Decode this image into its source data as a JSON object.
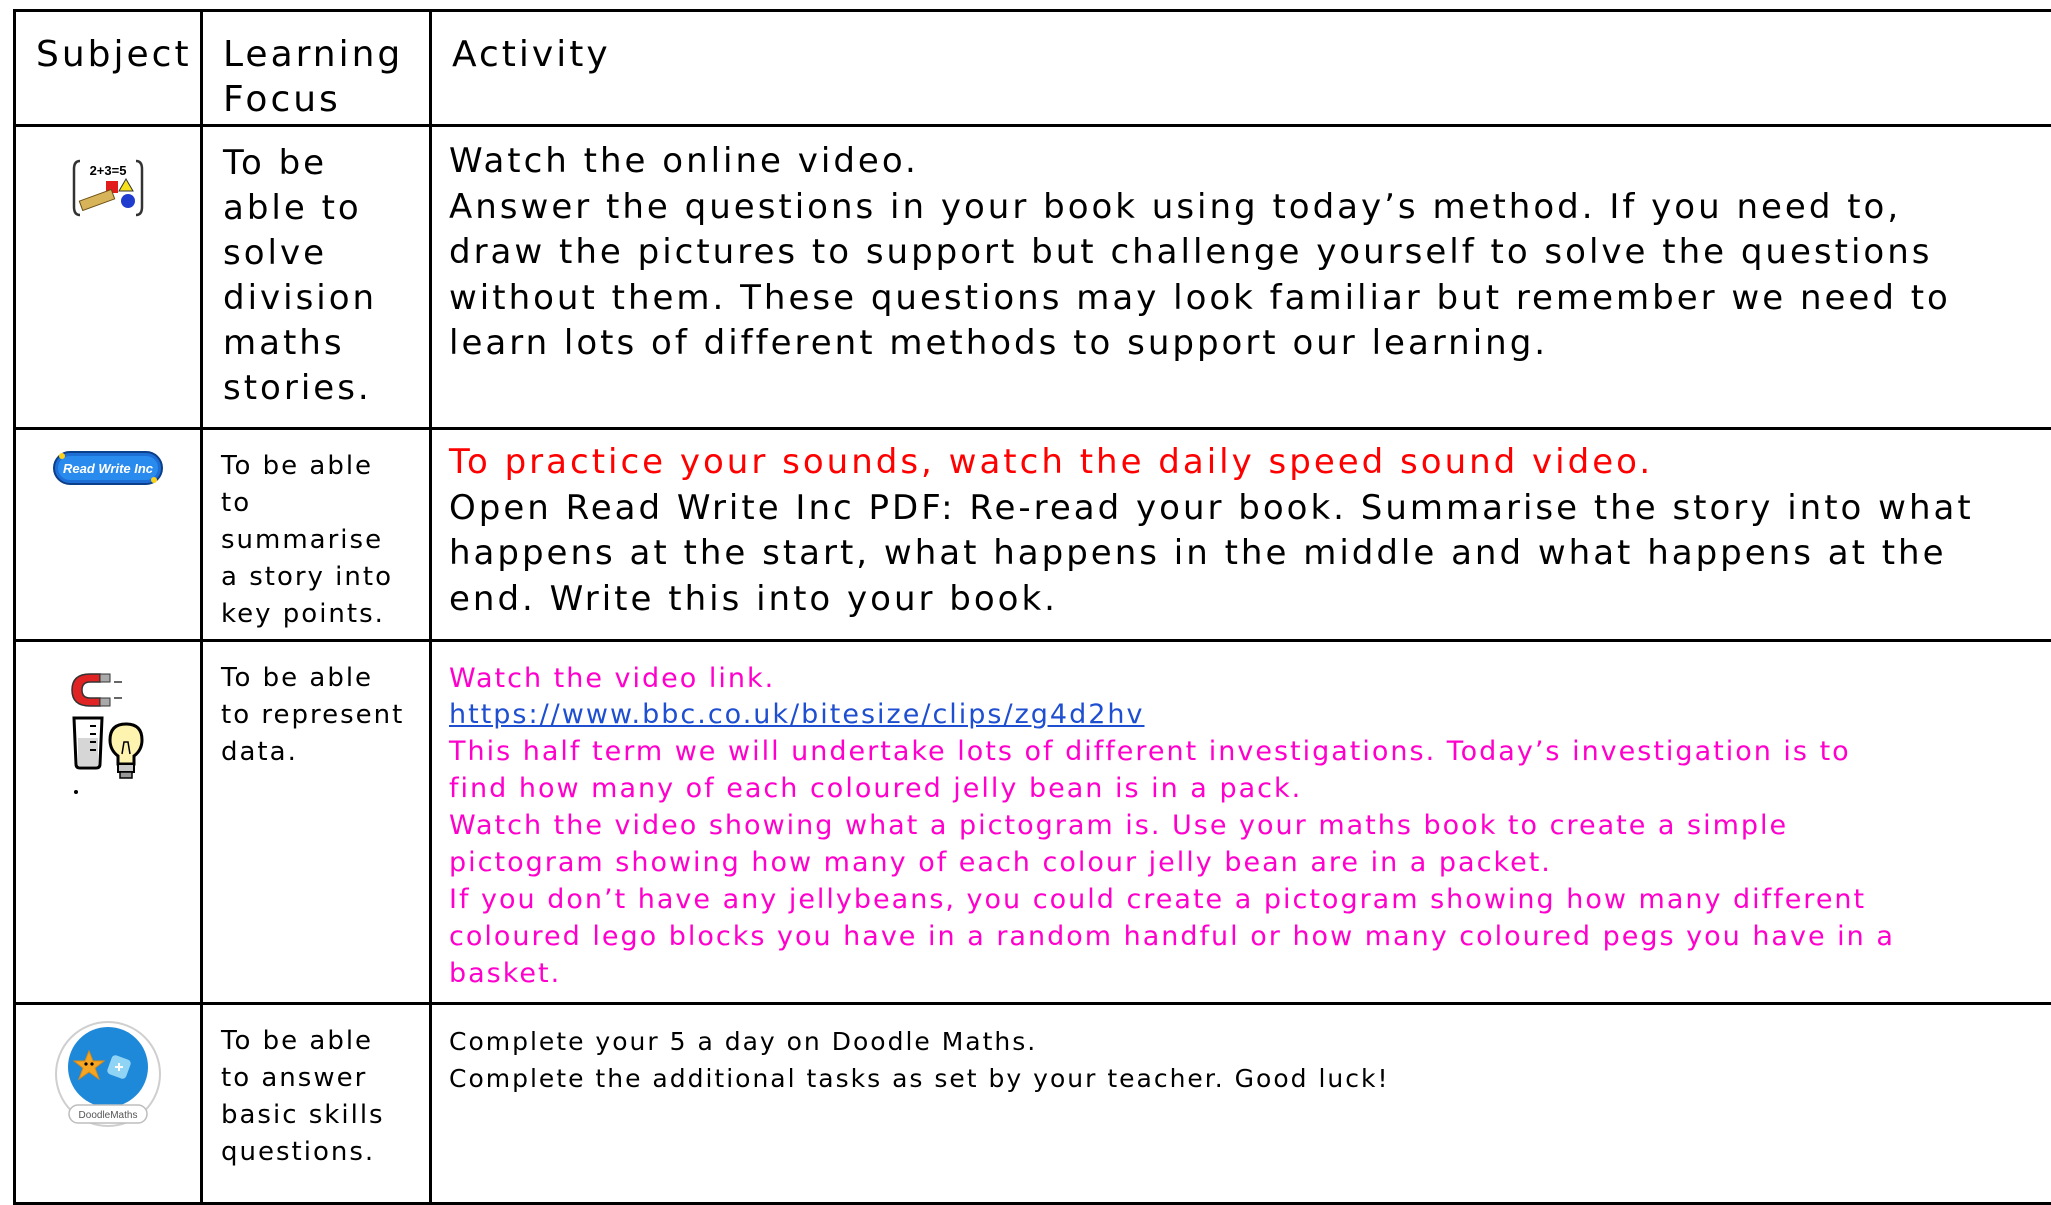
{
  "header": {
    "subject": "Subject",
    "focus_line1": "Learning",
    "focus_line2": "Focus",
    "activity": "Activity"
  },
  "rows": [
    {
      "icon": "maths-icon",
      "icon_text": "2+3=5",
      "focus": [
        "To be",
        "able to",
        "solve",
        "division",
        "maths",
        "stories."
      ],
      "activity": [
        "Watch the online video.",
        "Answer the questions in your book using today’s method. If you need to,",
        "draw the pictures to support but challenge yourself to solve the questions",
        "without them. These questions may look familiar but remember we need to",
        "learn lots of different methods to support our learning."
      ]
    },
    {
      "icon": "read-write-inc-logo",
      "icon_text": "Read Write Inc",
      "focus": [
        "To be able",
        "to",
        "summarise",
        "a story into",
        "key points."
      ],
      "activity_highlight": "To practice your sounds, watch the daily speed sound video.",
      "activity": [
        "Open Read Write Inc PDF: Re-read your book. Summarise the story into what",
        "happens at the start, what happens in the middle and what happens at the",
        "end. Write this into your book."
      ]
    },
    {
      "icon": "science-icon",
      "focus": [
        "To be able",
        "to represent",
        "data."
      ],
      "activity_intro": "Watch the video link.",
      "link": "https://www.bbc.co.uk/bitesize/clips/zg4d2hv",
      "activity": [
        "This half term we will undertake lots of different investigations. Today’s investigation is to",
        "find how many of each coloured jelly bean is in a pack.",
        "Watch the video showing what a pictogram is. Use your maths book to create a simple",
        "pictogram showing how many of each colour jelly bean are in a packet.",
        "If you don’t have any jellybeans, you could create a pictogram showing how many different",
        "coloured lego blocks you have in a random handful or how many coloured pegs you have in a",
        "basket."
      ]
    },
    {
      "icon": "doodlemaths-logo",
      "icon_text": "DoodleMaths",
      "focus": [
        "To be able",
        "to answer",
        "basic skills",
        "questions."
      ],
      "activity": [
        "Complete your 5 a day on Doodle Maths.",
        "Complete the additional tasks as set by your teacher. Good luck!"
      ]
    }
  ]
}
